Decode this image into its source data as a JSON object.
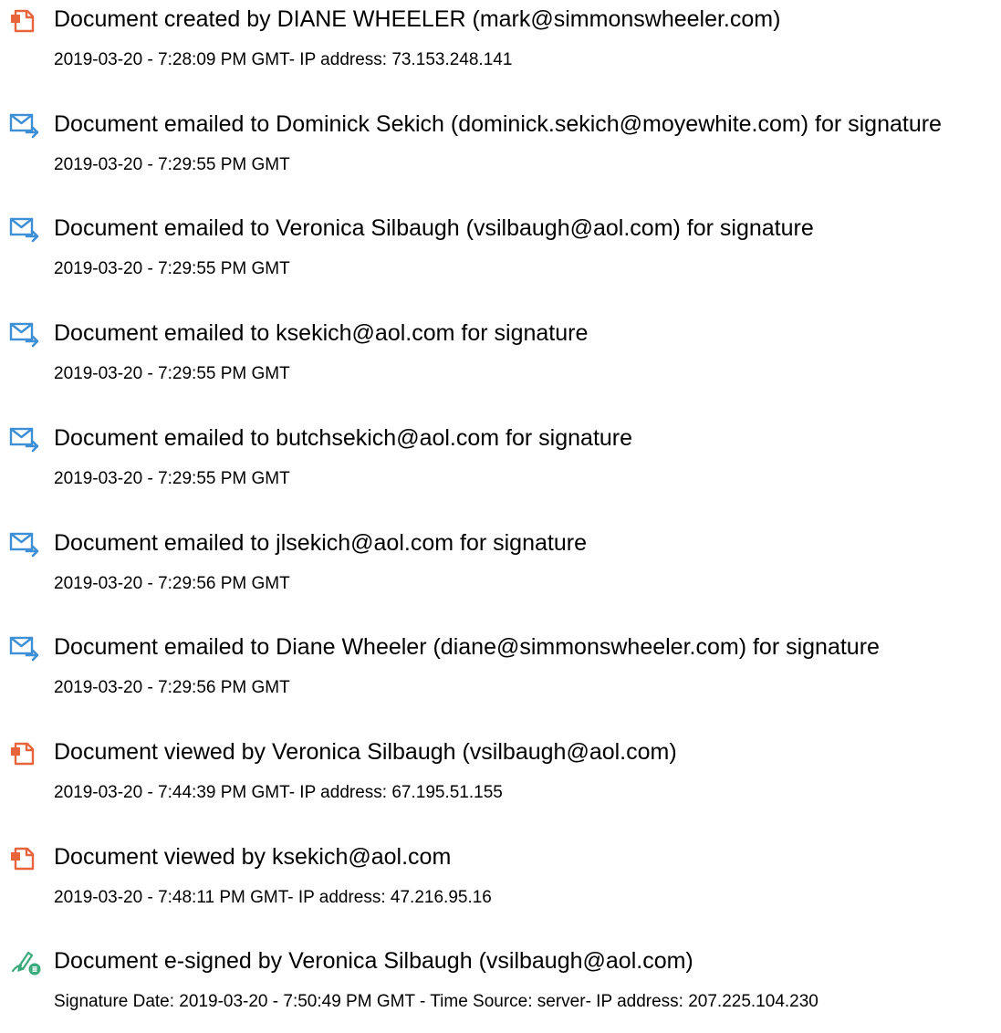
{
  "events": [
    {
      "icon": "document-created-icon",
      "title": "Document created by DIANE WHEELER (mark@simmonswheeler.com)",
      "detail": "2019-03-20 - 7:28:09 PM GMT- IP address: 73.153.248.141"
    },
    {
      "icon": "email-sent-icon",
      "title": "Document emailed to Dominick Sekich (dominick.sekich@moyewhite.com) for signature",
      "detail": "2019-03-20 - 7:29:55 PM GMT"
    },
    {
      "icon": "email-sent-icon",
      "title": "Document emailed to Veronica Silbaugh (vsilbaugh@aol.com) for signature",
      "detail": "2019-03-20 - 7:29:55 PM GMT"
    },
    {
      "icon": "email-sent-icon",
      "title": "Document emailed to ksekich@aol.com for signature",
      "detail": "2019-03-20 - 7:29:55 PM GMT"
    },
    {
      "icon": "email-sent-icon",
      "title": "Document emailed to butchsekich@aol.com for signature",
      "detail": "2019-03-20 - 7:29:55 PM GMT"
    },
    {
      "icon": "email-sent-icon",
      "title": "Document emailed to jlsekich@aol.com for signature",
      "detail": "2019-03-20 - 7:29:56 PM GMT"
    },
    {
      "icon": "email-sent-icon",
      "title": "Document emailed to Diane Wheeler (diane@simmonswheeler.com) for signature",
      "detail": "2019-03-20 - 7:29:56 PM GMT"
    },
    {
      "icon": "document-viewed-icon",
      "title": "Document viewed by Veronica Silbaugh (vsilbaugh@aol.com)",
      "detail": "2019-03-20 - 7:44:39 PM GMT- IP address: 67.195.51.155"
    },
    {
      "icon": "document-viewed-icon",
      "title": "Document viewed by ksekich@aol.com",
      "detail": "2019-03-20 - 7:48:11 PM GMT- IP address: 47.216.95.16"
    },
    {
      "icon": "e-signed-icon",
      "title": "Document e-signed by Veronica Silbaugh (vsilbaugh@aol.com)",
      "detail": "Signature Date: 2019-03-20 - 7:50:49 PM GMT - Time Source: server- IP address: 207.225.104.230"
    }
  ],
  "colors": {
    "document_icon": "#e8643c",
    "email_icon": "#3d8fd6",
    "signed_icon": "#3aaa7a"
  }
}
